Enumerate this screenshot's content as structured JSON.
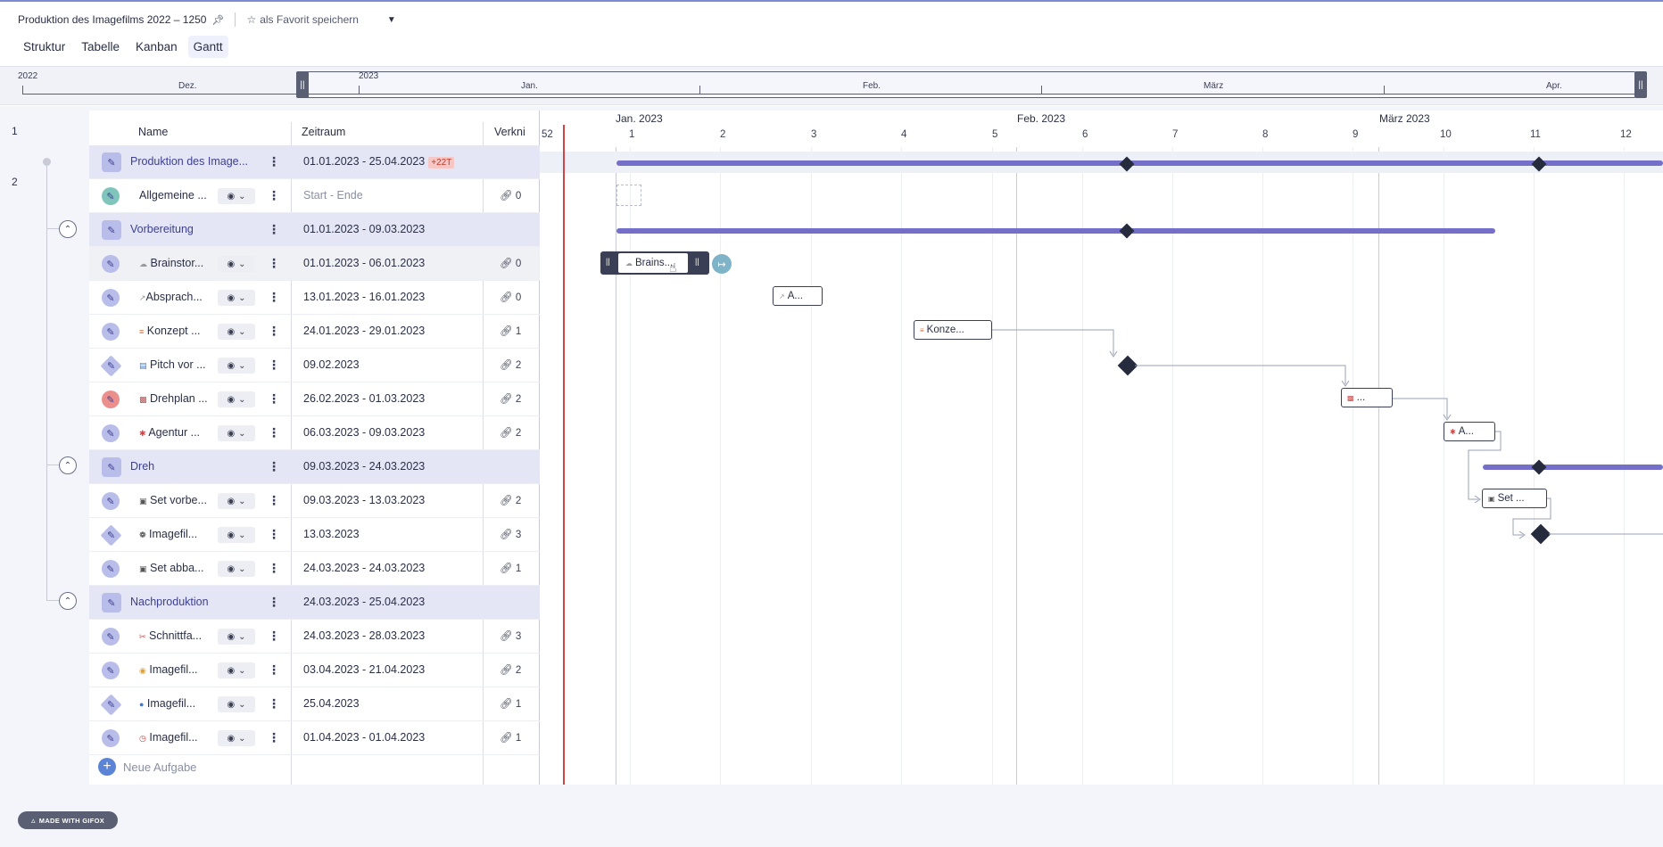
{
  "project": {
    "title": "Produktion des Imagefilms 2022 – 1250",
    "favorite_label": "als Favorit speichern"
  },
  "tabs": [
    {
      "label": "Struktur",
      "active": false
    },
    {
      "label": "Tabelle",
      "active": false
    },
    {
      "label": "Kanban",
      "active": false
    },
    {
      "label": "Gantt",
      "active": true
    }
  ],
  "timeline": {
    "years": [
      "2022",
      "2023"
    ],
    "months": [
      "Dez.",
      "Jan.",
      "Feb.",
      "März",
      "Apr."
    ]
  },
  "table": {
    "row_numbers": [
      "1",
      "2"
    ],
    "headers": {
      "name": "Name",
      "period": "Zeitraum",
      "links": "Verkni"
    },
    "new_task_label": "Neue Aufgabe",
    "rows": [
      {
        "name": "Produktion des Image...",
        "date": "01.01.2023 - 25.04.2023",
        "badge": "+22T",
        "links": "",
        "group": true
      },
      {
        "name": "Allgemeine ...",
        "date": "Start - Ende",
        "links": "0",
        "group": false
      },
      {
        "name": "Vorbereitung",
        "date": "01.01.2023 - 09.03.2023",
        "links": "",
        "group": true
      },
      {
        "name": "Brainstor...",
        "date": "01.01.2023 - 06.01.2023",
        "links": "0",
        "group": false
      },
      {
        "name": "Absprach...",
        "date": "13.01.2023 - 16.01.2023",
        "links": "0",
        "group": false
      },
      {
        "name": "Konzept ...",
        "date": "24.01.2023 - 29.01.2023",
        "links": "1",
        "group": false
      },
      {
        "name": "Pitch vor ...",
        "date": "09.02.2023",
        "links": "2",
        "group": false
      },
      {
        "name": "Drehplan ...",
        "date": "26.02.2023 - 01.03.2023",
        "links": "2",
        "group": false
      },
      {
        "name": "Agentur ...",
        "date": "06.03.2023 - 09.03.2023",
        "links": "2",
        "group": false
      },
      {
        "name": "Dreh",
        "date": "09.03.2023 - 24.03.2023",
        "links": "",
        "group": true
      },
      {
        "name": "Set vorbe...",
        "date": "09.03.2023 - 13.03.2023",
        "links": "2",
        "group": false
      },
      {
        "name": "Imagefil...",
        "date": "13.03.2023",
        "links": "3",
        "group": false
      },
      {
        "name": "Set abba...",
        "date": "24.03.2023 - 24.03.2023",
        "links": "1",
        "group": false
      },
      {
        "name": "Nachproduktion",
        "date": "24.03.2023 - 25.04.2023",
        "links": "",
        "group": true
      },
      {
        "name": "Schnittfa...",
        "date": "24.03.2023 - 28.03.2023",
        "links": "3",
        "group": false
      },
      {
        "name": "Imagefil...",
        "date": "03.04.2023 - 21.04.2023",
        "links": "2",
        "group": false
      },
      {
        "name": "Imagefil...",
        "date": "25.04.2023",
        "links": "1",
        "group": false
      },
      {
        "name": "Imagefil...",
        "date": "01.04.2023 - 01.04.2023",
        "links": "1",
        "group": false
      }
    ]
  },
  "gantt": {
    "months": [
      "Jan. 2023",
      "Feb. 2023",
      "März 2023"
    ],
    "weeks": [
      "52",
      "1",
      "2",
      "3",
      "4",
      "5",
      "6",
      "7",
      "8",
      "9",
      "10",
      "11",
      "12"
    ],
    "tasks": {
      "brainstorm": "Brains...",
      "absprache": "A...",
      "konzept": "Konze...",
      "drehplan": "...",
      "agentur": "A...",
      "set": "Set ..."
    }
  },
  "footer": {
    "badge": "MADE WITH GIFOX"
  }
}
